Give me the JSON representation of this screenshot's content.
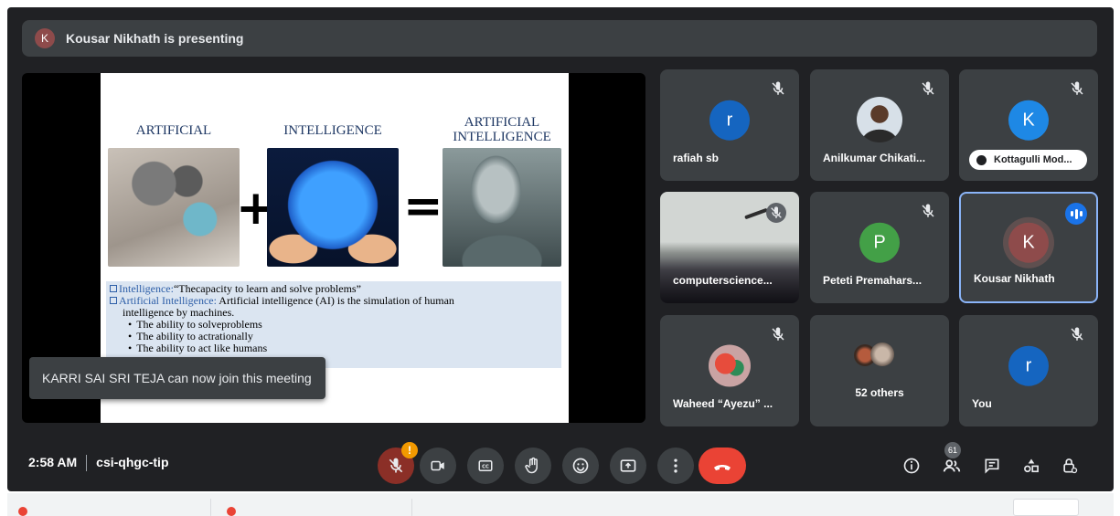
{
  "presenting_banner": {
    "avatar_letter": "K",
    "text": "Kousar Nikhath is presenting"
  },
  "slide": {
    "heading_1": "ARTIFICIAL",
    "heading_2": "INTELLIGENCE",
    "heading_3": "ARTIFICIAL INTELLIGENCE",
    "plus": "+",
    "equals": "=",
    "line_1_label": "Intelligence:",
    "line_1_text": "“Thecapacity to learn and solve problems”",
    "line_2_label": "Artificial Intelligence:",
    "line_2_text": "Artificial intelligence (AI) is the simulation of human",
    "line_2_cont": "intelligence by machines.",
    "bullets": [
      "The ability to solveproblems",
      "The ability to actrationally",
      "The ability to act like humans"
    ]
  },
  "toast": {
    "text": "KARRI SAI SRI TEJA can now join this meeting"
  },
  "participants": [
    {
      "name": "rafiah sb",
      "avatar": "r",
      "color": "#1565c0"
    },
    {
      "name": "Anilkumar Chikati...",
      "avatar": "",
      "color": "#b8c7d6"
    },
    {
      "name": "Kottagulli Mod...",
      "avatar": "K",
      "color": "#1e88e5"
    },
    {
      "name": "computerscience...",
      "avatar": "",
      "color": "#8a8f8c"
    },
    {
      "name": "Peteti Premahars...",
      "avatar": "P",
      "color": "#43a047"
    },
    {
      "name": "Kousar Nikhath",
      "avatar": "K",
      "color": "#8e4b4b"
    },
    {
      "name": "Waheed “Ayezu” ...",
      "avatar": "",
      "color": "#c94b4b"
    },
    {
      "name": "52 others",
      "avatar": "",
      "color": "#6d5f56"
    },
    {
      "name": "You",
      "avatar": "r",
      "color": "#1565c0"
    }
  ],
  "controls": {
    "time": "2:58 AM",
    "meeting_code": "csi-qhgc-tip",
    "mic_warning": "!",
    "people_count": "61"
  },
  "colors": {
    "background": "#202124",
    "tile": "#3c4043",
    "end_call": "#ea4335",
    "active_border": "#8ab4f8"
  }
}
